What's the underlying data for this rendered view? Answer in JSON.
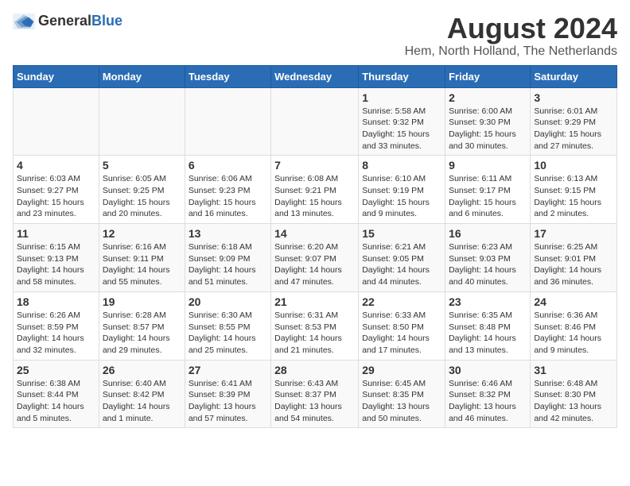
{
  "logo": {
    "text_general": "General",
    "text_blue": "Blue"
  },
  "header": {
    "title": "August 2024",
    "subtitle": "Hem, North Holland, The Netherlands"
  },
  "weekdays": [
    "Sunday",
    "Monday",
    "Tuesday",
    "Wednesday",
    "Thursday",
    "Friday",
    "Saturday"
  ],
  "weeks": [
    [
      {
        "day": "",
        "info": ""
      },
      {
        "day": "",
        "info": ""
      },
      {
        "day": "",
        "info": ""
      },
      {
        "day": "",
        "info": ""
      },
      {
        "day": "1",
        "info": "Sunrise: 5:58 AM\nSunset: 9:32 PM\nDaylight: 15 hours and 33 minutes."
      },
      {
        "day": "2",
        "info": "Sunrise: 6:00 AM\nSunset: 9:30 PM\nDaylight: 15 hours and 30 minutes."
      },
      {
        "day": "3",
        "info": "Sunrise: 6:01 AM\nSunset: 9:29 PM\nDaylight: 15 hours and 27 minutes."
      }
    ],
    [
      {
        "day": "4",
        "info": "Sunrise: 6:03 AM\nSunset: 9:27 PM\nDaylight: 15 hours and 23 minutes."
      },
      {
        "day": "5",
        "info": "Sunrise: 6:05 AM\nSunset: 9:25 PM\nDaylight: 15 hours and 20 minutes."
      },
      {
        "day": "6",
        "info": "Sunrise: 6:06 AM\nSunset: 9:23 PM\nDaylight: 15 hours and 16 minutes."
      },
      {
        "day": "7",
        "info": "Sunrise: 6:08 AM\nSunset: 9:21 PM\nDaylight: 15 hours and 13 minutes."
      },
      {
        "day": "8",
        "info": "Sunrise: 6:10 AM\nSunset: 9:19 PM\nDaylight: 15 hours and 9 minutes."
      },
      {
        "day": "9",
        "info": "Sunrise: 6:11 AM\nSunset: 9:17 PM\nDaylight: 15 hours and 6 minutes."
      },
      {
        "day": "10",
        "info": "Sunrise: 6:13 AM\nSunset: 9:15 PM\nDaylight: 15 hours and 2 minutes."
      }
    ],
    [
      {
        "day": "11",
        "info": "Sunrise: 6:15 AM\nSunset: 9:13 PM\nDaylight: 14 hours and 58 minutes."
      },
      {
        "day": "12",
        "info": "Sunrise: 6:16 AM\nSunset: 9:11 PM\nDaylight: 14 hours and 55 minutes."
      },
      {
        "day": "13",
        "info": "Sunrise: 6:18 AM\nSunset: 9:09 PM\nDaylight: 14 hours and 51 minutes."
      },
      {
        "day": "14",
        "info": "Sunrise: 6:20 AM\nSunset: 9:07 PM\nDaylight: 14 hours and 47 minutes."
      },
      {
        "day": "15",
        "info": "Sunrise: 6:21 AM\nSunset: 9:05 PM\nDaylight: 14 hours and 44 minutes."
      },
      {
        "day": "16",
        "info": "Sunrise: 6:23 AM\nSunset: 9:03 PM\nDaylight: 14 hours and 40 minutes."
      },
      {
        "day": "17",
        "info": "Sunrise: 6:25 AM\nSunset: 9:01 PM\nDaylight: 14 hours and 36 minutes."
      }
    ],
    [
      {
        "day": "18",
        "info": "Sunrise: 6:26 AM\nSunset: 8:59 PM\nDaylight: 14 hours and 32 minutes."
      },
      {
        "day": "19",
        "info": "Sunrise: 6:28 AM\nSunset: 8:57 PM\nDaylight: 14 hours and 29 minutes."
      },
      {
        "day": "20",
        "info": "Sunrise: 6:30 AM\nSunset: 8:55 PM\nDaylight: 14 hours and 25 minutes."
      },
      {
        "day": "21",
        "info": "Sunrise: 6:31 AM\nSunset: 8:53 PM\nDaylight: 14 hours and 21 minutes."
      },
      {
        "day": "22",
        "info": "Sunrise: 6:33 AM\nSunset: 8:50 PM\nDaylight: 14 hours and 17 minutes."
      },
      {
        "day": "23",
        "info": "Sunrise: 6:35 AM\nSunset: 8:48 PM\nDaylight: 14 hours and 13 minutes."
      },
      {
        "day": "24",
        "info": "Sunrise: 6:36 AM\nSunset: 8:46 PM\nDaylight: 14 hours and 9 minutes."
      }
    ],
    [
      {
        "day": "25",
        "info": "Sunrise: 6:38 AM\nSunset: 8:44 PM\nDaylight: 14 hours and 5 minutes."
      },
      {
        "day": "26",
        "info": "Sunrise: 6:40 AM\nSunset: 8:42 PM\nDaylight: 14 hours and 1 minute."
      },
      {
        "day": "27",
        "info": "Sunrise: 6:41 AM\nSunset: 8:39 PM\nDaylight: 13 hours and 57 minutes."
      },
      {
        "day": "28",
        "info": "Sunrise: 6:43 AM\nSunset: 8:37 PM\nDaylight: 13 hours and 54 minutes."
      },
      {
        "day": "29",
        "info": "Sunrise: 6:45 AM\nSunset: 8:35 PM\nDaylight: 13 hours and 50 minutes."
      },
      {
        "day": "30",
        "info": "Sunrise: 6:46 AM\nSunset: 8:32 PM\nDaylight: 13 hours and 46 minutes."
      },
      {
        "day": "31",
        "info": "Sunrise: 6:48 AM\nSunset: 8:30 PM\nDaylight: 13 hours and 42 minutes."
      }
    ]
  ]
}
